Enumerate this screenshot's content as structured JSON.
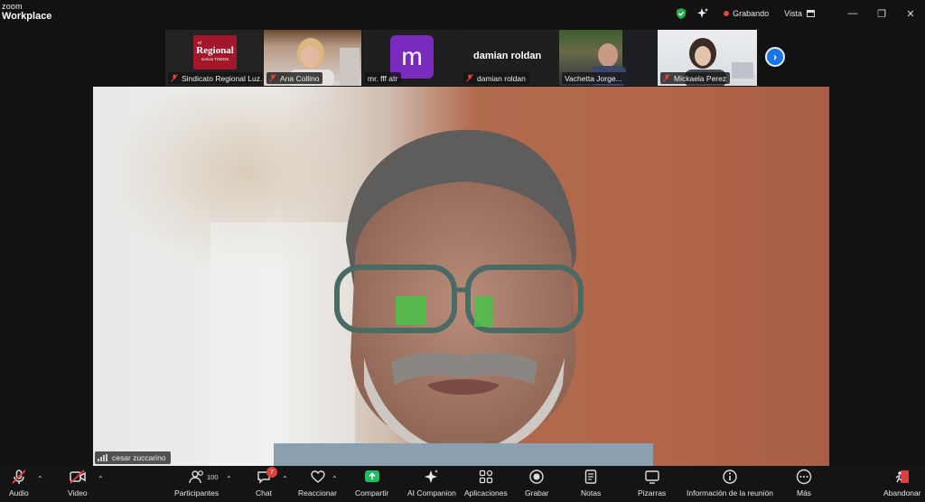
{
  "app": {
    "logo_top": "zoom",
    "logo_bottom": "Workplace"
  },
  "titlebar": {
    "recording": "Grabando",
    "view": "Vista",
    "minimize": "—",
    "restore": "❐",
    "close": "✕"
  },
  "participants": [
    {
      "name": "Sindicato Regional Luz...",
      "muted": true
    },
    {
      "name": "Ana Collino",
      "muted": true
    },
    {
      "name": "mr. fff atr",
      "muted": false,
      "avatar_letter": "m",
      "avatar_color": "#7a2bbd"
    },
    {
      "name": "damian roldan",
      "muted": true,
      "display_name": "damian roldan"
    },
    {
      "name": "Vachetta Jorge...",
      "muted": false
    },
    {
      "name": "Mickaela Perez",
      "muted": true
    }
  ],
  "regional_logo": {
    "top": "el",
    "main": "Regional",
    "sub": "somos TODOS"
  },
  "main_speaker": {
    "name": "cesar zuccarino"
  },
  "toolbar": {
    "audio": "Audio",
    "video": "Video",
    "participants": "Participantes",
    "participants_count": "100",
    "chat": "Chat",
    "chat_badge": "7",
    "react": "Reaccionar",
    "share": "Compartir",
    "ai": "AI Companion",
    "apps": "Aplicaciones",
    "record": "Grabar",
    "notes": "Notas",
    "whiteboards": "Pizarras",
    "meeting_info": "Información de la reunión",
    "more": "Más",
    "leave": "Abandonar"
  },
  "colors": {
    "share_green": "#1dbf63",
    "accent_blue": "#1a73e8",
    "mute_red": "#e8443a"
  }
}
